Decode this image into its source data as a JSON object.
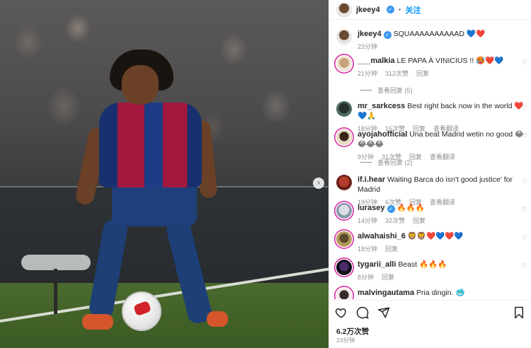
{
  "header": {
    "username": "jkeey4",
    "follow_label": "关注",
    "separator": "•"
  },
  "caption": {
    "username": "jkeey4",
    "text": "SQUAAAAAAAAAAD",
    "emojis": "💙❤️",
    "time": "23分钟"
  },
  "comments": [
    {
      "username": "___malkia",
      "text": "LE PAPA À VINICIUS !!",
      "emojis": "🥵❤️💙",
      "time": "21分钟",
      "likes": "312次赞",
      "reply": "回复",
      "translate": ""
    },
    {
      "username": "mr_sarkcess",
      "text": "Best right back now in the world",
      "emojis": "❤️💙🙏",
      "time": "18分钟",
      "likes": "15次赞",
      "reply": "回复",
      "translate": "查看翻译"
    },
    {
      "username": "ayojahofficial",
      "text": "Una beat Madrid wetin no good",
      "emojis": "😂😂😂😂",
      "time": "9分钟",
      "likes": "31次赞",
      "reply": "回复",
      "translate": "查看翻译"
    },
    {
      "username": "if.i.hear",
      "text": "Waiting Barca do isn't good justice' for Madrid",
      "emojis": "",
      "time": "19分钟",
      "likes": "6次赞",
      "reply": "回复",
      "translate": "查看翻译"
    },
    {
      "username": "lurasey",
      "text": "",
      "emojis": "🔥🔥🔥",
      "time": "14分钟",
      "likes": "32次赞",
      "reply": "回复",
      "translate": ""
    },
    {
      "username": "alwahaishi_6",
      "text": "",
      "emojis": "🦁🦁❤️💙❤️💙",
      "time": "18分钟",
      "likes": "",
      "reply": "回复",
      "translate": ""
    },
    {
      "username": "tygarii_alli",
      "text": "Beast",
      "emojis": "🔥🔥🔥",
      "time": "8分钟",
      "likes": "",
      "reply": "回复",
      "translate": ""
    },
    {
      "username": "malvingautama",
      "text": "Pria dingin.",
      "emojis": "🥶",
      "time": "",
      "likes": "",
      "reply": "",
      "translate": ""
    }
  ],
  "view_replies": [
    {
      "label": "查看回复 (5)"
    },
    {
      "label": "查看回复 (2)"
    }
  ],
  "footer": {
    "likes": "6.2万次赞",
    "time": "23分钟"
  },
  "icons": {
    "like": "heart-outline-icon",
    "comment": "comment-bubble-icon",
    "share": "paper-plane-icon",
    "save": "bookmark-icon",
    "verified": "verified-badge-icon",
    "comment_like": "heart-small-icon",
    "next": "chevron-right-icon"
  },
  "colors": {
    "accent": "#0095f6",
    "verified": "#3897f0",
    "meta": "#8e8e8e",
    "text": "#262626"
  }
}
